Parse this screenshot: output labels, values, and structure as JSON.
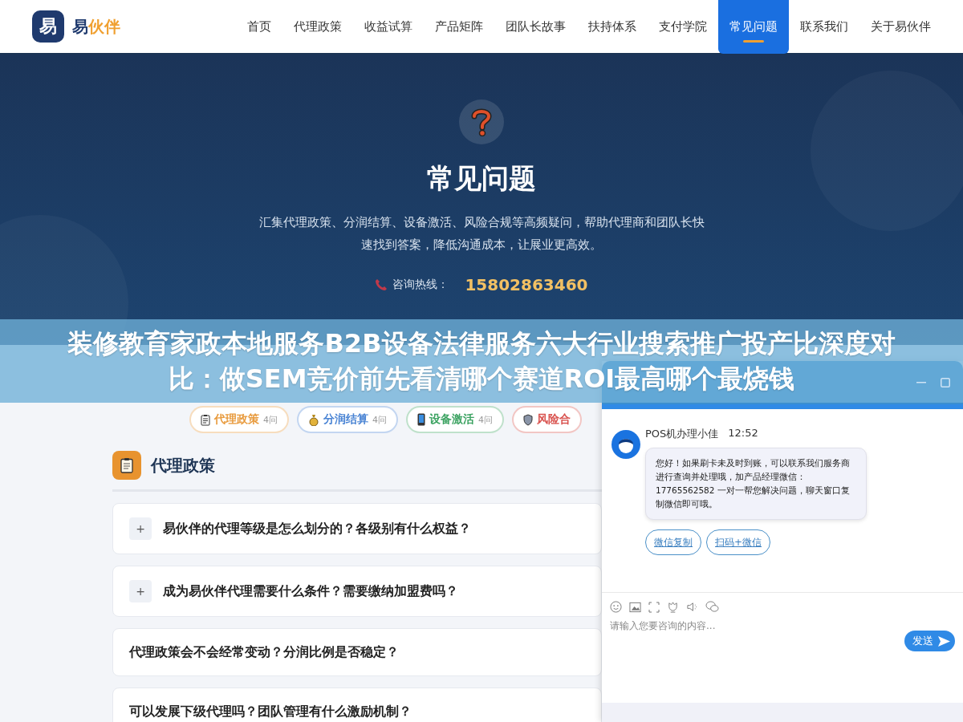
{
  "header": {
    "logo_mark": "易",
    "logo_name": [
      {
        "text": "易",
        "accent": false
      },
      {
        "text": "伙伴",
        "accent": true
      }
    ],
    "nav": [
      {
        "label": "首页",
        "selected": false
      },
      {
        "label": "代理政策",
        "selected": false
      },
      {
        "label": "收益试算",
        "selected": false
      },
      {
        "label": "产品矩阵",
        "selected": false
      },
      {
        "label": "团队长故事",
        "selected": false
      },
      {
        "label": "扶持体系",
        "selected": false
      },
      {
        "label": "支付学院",
        "selected": false
      },
      {
        "label": "常见问题",
        "selected": true
      },
      {
        "label": "联系我们",
        "selected": false
      },
      {
        "label": "关于易伙伴",
        "selected": false
      }
    ]
  },
  "hero": {
    "title": "常见问题",
    "description": "汇集代理政策、分润结算、设备激活、风险合规等高频疑问，帮助代理商和团队长快速找到答案，降低沟通成本，让展业更高效。",
    "hotline_label": "咨询热线：",
    "hotline_number": "15802863460"
  },
  "categories": [
    {
      "label": "代理政策",
      "count": "4问",
      "color": "#e89a3c"
    },
    {
      "label": "分润结算",
      "count": "4问",
      "color": "#4a84d4"
    },
    {
      "label": "设备激活",
      "count": "4问",
      "color": "#3fa464"
    },
    {
      "label": "风险合",
      "color": "#d9534f"
    }
  ],
  "section": {
    "title": "代理政策",
    "questions": [
      {
        "toggle": "+",
        "text": "易伙伴的代理等级是怎么划分的？各级别有什么权益？"
      },
      {
        "toggle": "+",
        "text": "成为易伙伴代理需要什么条件？需要缴纳加盟费吗？"
      },
      {
        "text": "代理政策会不会经常变动？分润比例是否稳定？"
      },
      {
        "text": "可以发展下级代理吗？团队管理有什么激励机制？"
      }
    ]
  },
  "chat": {
    "agent_name": "POS机办理小佳",
    "time": "12:52",
    "message": "您好！如果刷卡未及时到账，可以联系我们服务商进行查询并处理哦，加产品经理微信：17765562582 一对一帮您解决问题，聊天窗口复制微信即可哦。",
    "quick_replies": [
      "微信复制",
      "扫码+微信"
    ],
    "placeholder": "请输入您要咨询的内容...",
    "send": "发送"
  },
  "banner": {
    "lines": [
      "装修教育家政本地服务B2B设备法律服务六大行业搜索推广投产比深度对",
      "比：做SEM竞价前先看清哪个赛道ROI最高哪个最烧钱"
    ]
  }
}
